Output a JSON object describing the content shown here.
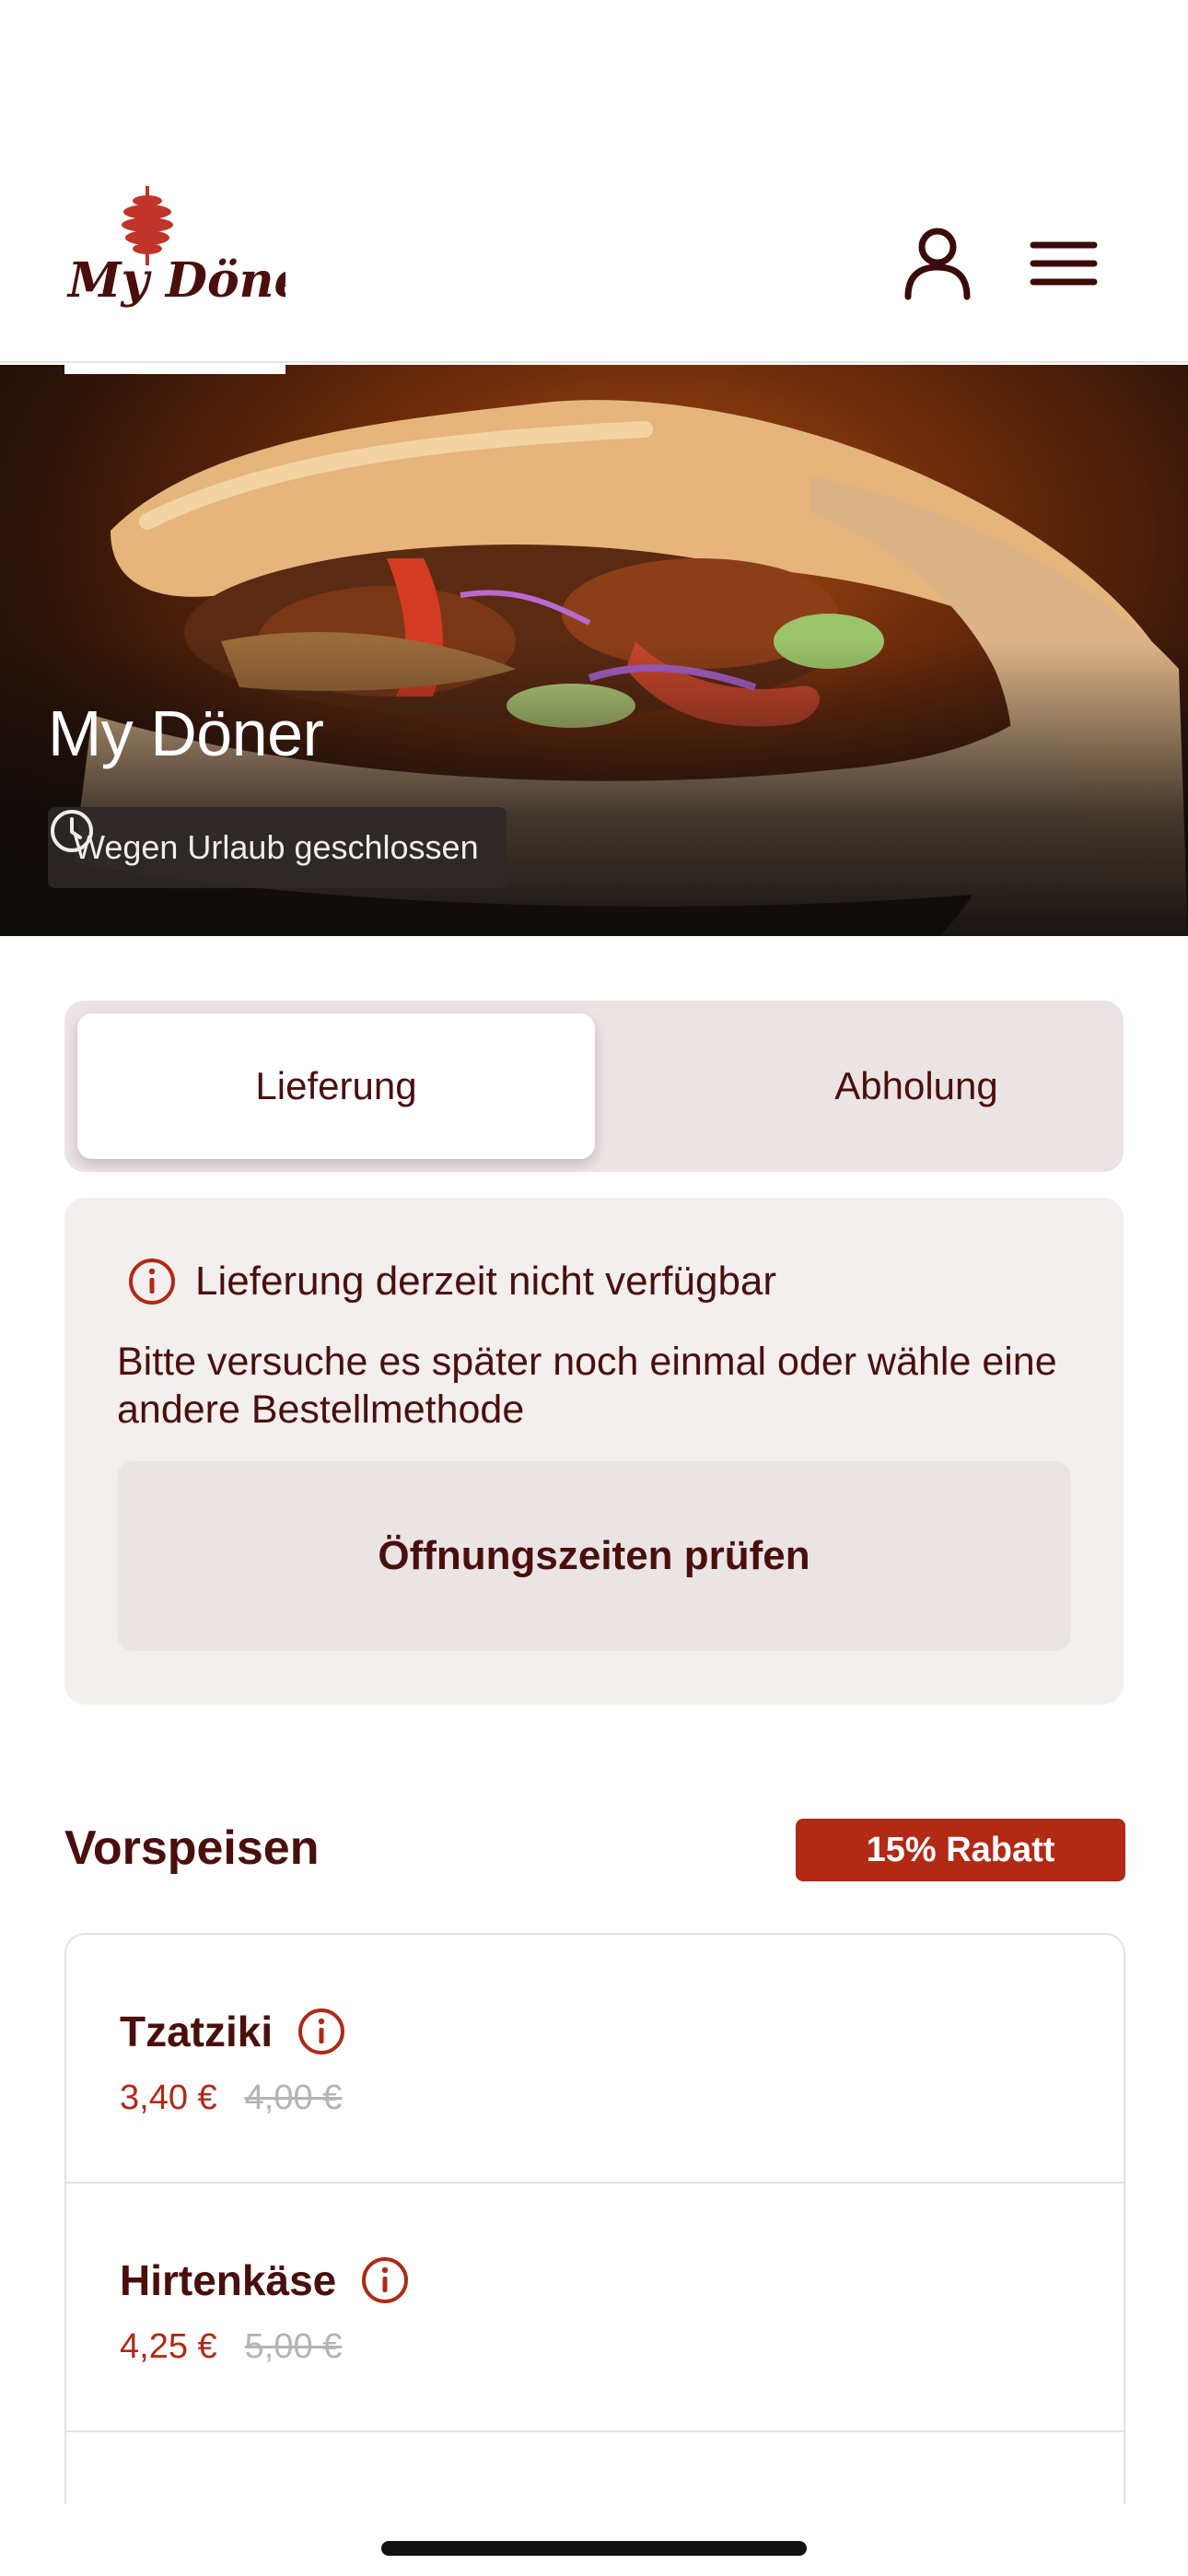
{
  "brand": {
    "logo_text": "My Döner",
    "color_primary": "#4a0f0d",
    "color_accent": "#b02a16"
  },
  "header": {
    "account_icon": "user-icon",
    "menu_icon": "hamburger-menu-icon"
  },
  "hero": {
    "title": "My Döner",
    "status_icon": "clock-icon",
    "status_text": "Wegen Urlaub geschlossen"
  },
  "order_mode": {
    "options": [
      "Lieferung",
      "Abholung"
    ],
    "selected": "Lieferung"
  },
  "notice": {
    "icon": "info-icon",
    "title": "Lieferung derzeit nicht verfügbar",
    "body": "Bitte versuche es später noch einmal oder wähle eine andere Bestellmethode",
    "button_label": "Öffnungszeiten prüfen"
  },
  "section": {
    "title": "Vorspeisen",
    "discount_badge": "15% Rabatt",
    "items": [
      {
        "name": "Tzatziki",
        "price": "3,40 €",
        "old_price": "4,00 €",
        "info_icon": "info-icon"
      },
      {
        "name": "Hirtenkäse",
        "price": "4,25 €",
        "old_price": "5,00 €",
        "info_icon": "info-icon"
      }
    ]
  }
}
